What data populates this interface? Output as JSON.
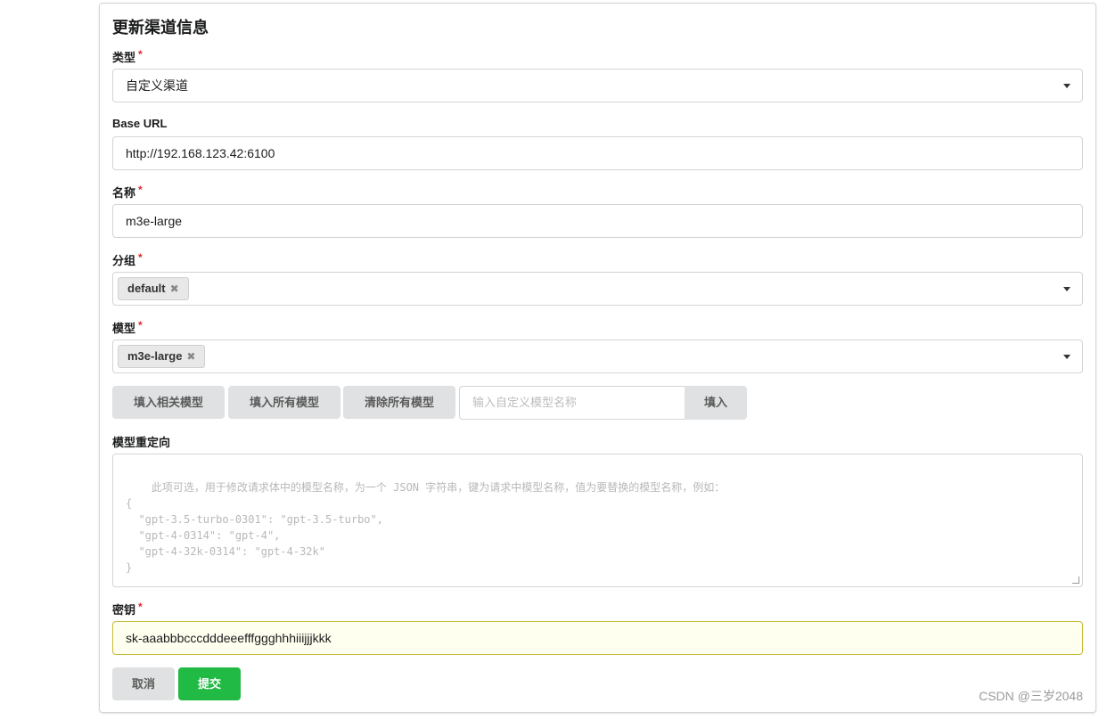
{
  "form": {
    "title": "更新渠道信息",
    "required_mark": "*",
    "type": {
      "label": "类型",
      "value": "自定义渠道"
    },
    "base_url": {
      "label": "Base URL",
      "value": "http://192.168.123.42:6100"
    },
    "name": {
      "label": "名称",
      "value": "m3e-large"
    },
    "group": {
      "label": "分组",
      "chips": [
        "default"
      ]
    },
    "models": {
      "label": "模型",
      "chips": [
        "m3e-large"
      ]
    },
    "model_buttons": {
      "fill_related": "填入相关模型",
      "fill_all": "填入所有模型",
      "clear_all": "清除所有模型"
    },
    "custom_model": {
      "placeholder": "输入自定义模型名称",
      "fill_button": "填入"
    },
    "model_mapping": {
      "label": "模型重定向",
      "placeholder": "此项可选，用于修改请求体中的模型名称，为一个 JSON 字符串，键为请求中模型名称，值为要替换的模型名称，例如：\n{\n  \"gpt-3.5-turbo-0301\": \"gpt-3.5-turbo\",\n  \"gpt-4-0314\": \"gpt-4\",\n  \"gpt-4-32k-0314\": \"gpt-4-32k\"\n}"
    },
    "key": {
      "label": "密钥",
      "value": "sk-aaabbbcccdddeeefffggghhhiiijjjkkk"
    },
    "cancel_button": "取消",
    "submit_button": "提交"
  },
  "watermark": "CSDN @三岁2048",
  "icons": {
    "chip_remove": "close-icon",
    "dropdown": "caret-down-icon"
  },
  "colors": {
    "submit": "#21ba45",
    "required": "#db2828",
    "key_bg": "#fffff0"
  }
}
